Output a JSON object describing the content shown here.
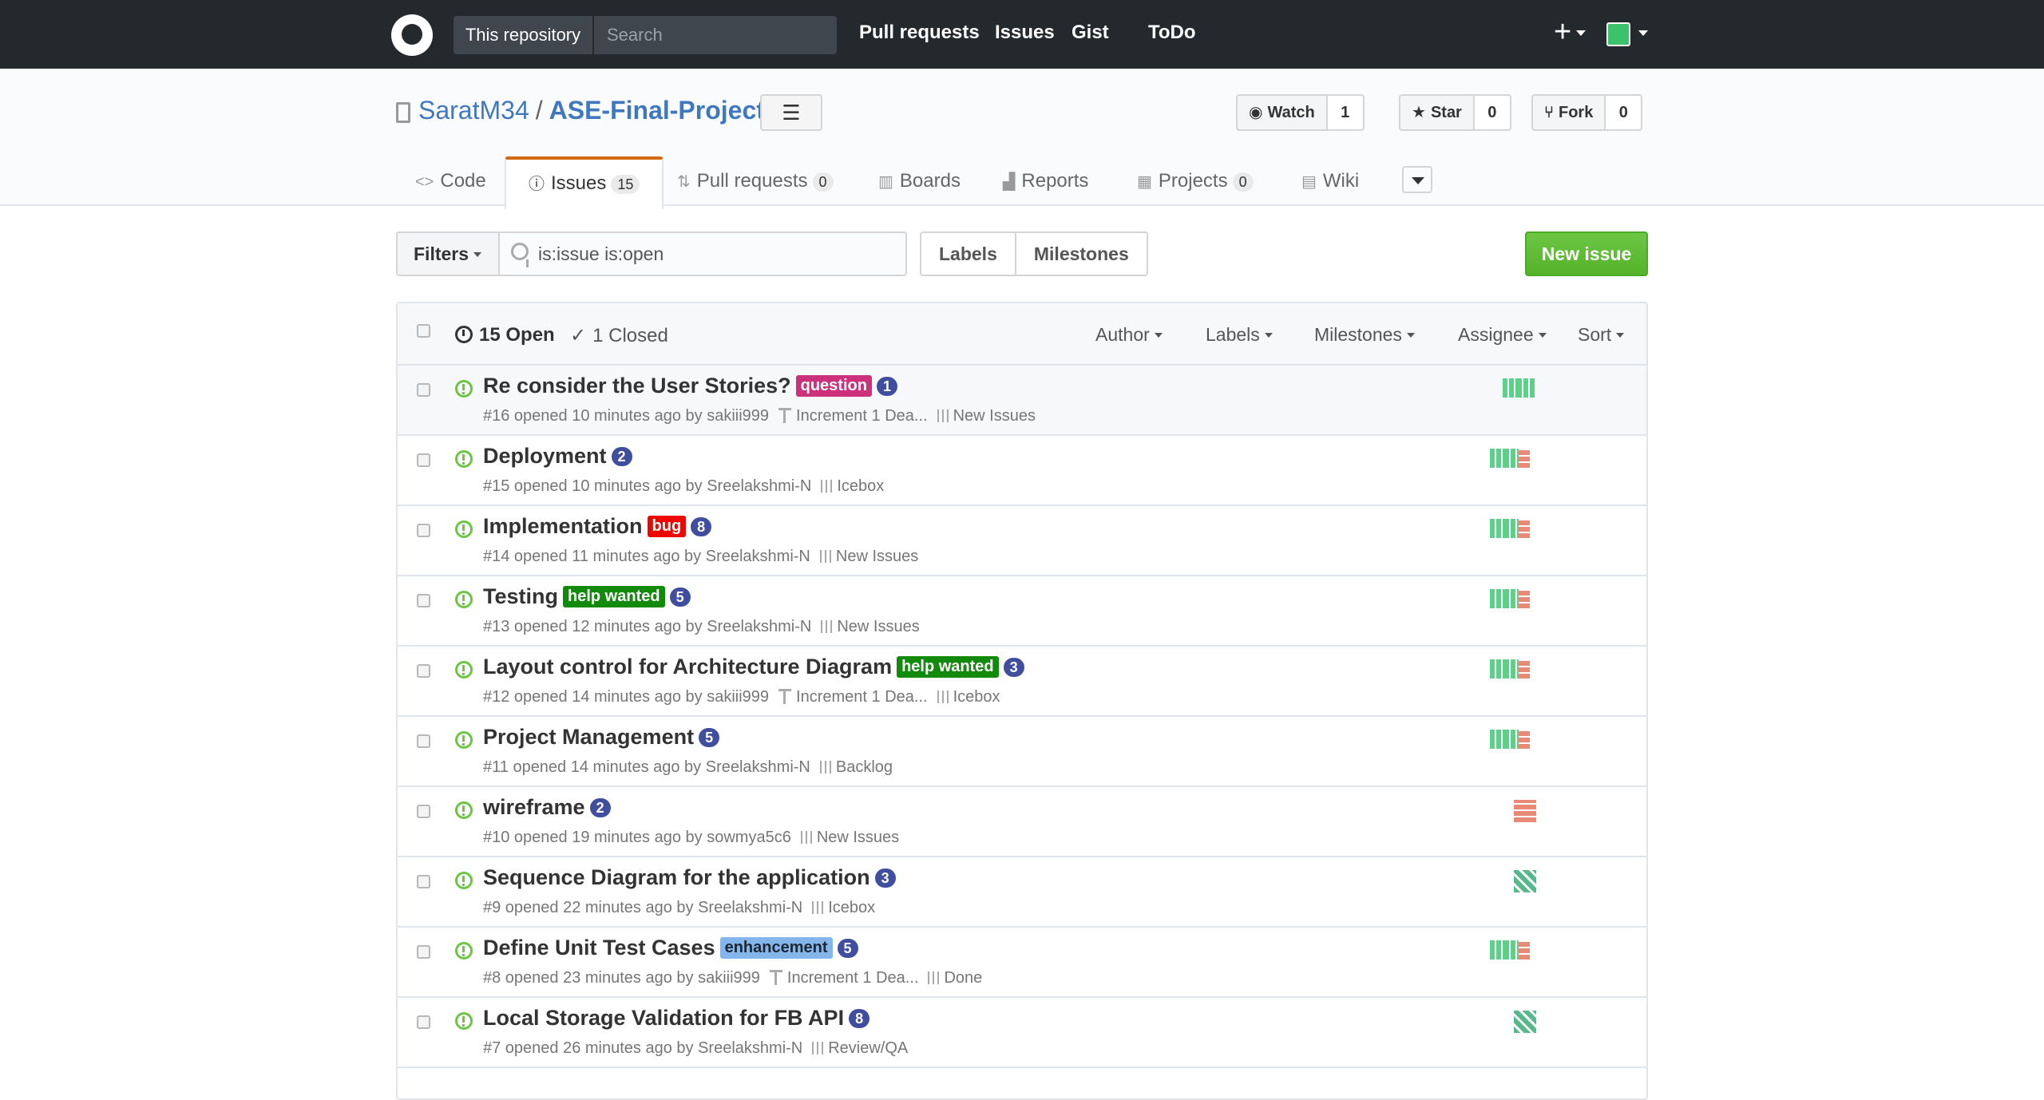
{
  "header": {
    "scope_label": "This repository",
    "search_placeholder": "Search",
    "nav": [
      "Pull requests",
      "Issues",
      "Gist",
      "ToDo"
    ],
    "plus_label": "+"
  },
  "repo": {
    "owner": "SaratM34",
    "separator": "/",
    "name": "ASE-Final-Project",
    "list_icon": "☰",
    "watch": {
      "label": "Watch",
      "count": "1"
    },
    "star": {
      "label": "Star",
      "count": "0"
    },
    "fork": {
      "label": "Fork",
      "count": "0"
    }
  },
  "tabs": {
    "code": {
      "label": "Code",
      "icon": "<>"
    },
    "issues": {
      "label": "Issues",
      "count": "15"
    },
    "pulls": {
      "label": "Pull requests",
      "count": "0"
    },
    "boards": {
      "label": "Boards"
    },
    "reports": {
      "label": "Reports"
    },
    "projects": {
      "label": "Projects",
      "count": "0"
    },
    "wiki": {
      "label": "Wiki"
    }
  },
  "subnav": {
    "filters": "Filters",
    "query": "is:issue is:open",
    "labels": "Labels",
    "milestones": "Milestones",
    "new_issue": "New issue"
  },
  "list_header": {
    "open": "15 Open",
    "closed_check": "✓",
    "closed": "1 Closed",
    "author": "Author",
    "labels": "Labels",
    "milestones": "Milestones",
    "assignee": "Assignee",
    "sort": "Sort"
  },
  "colors": {
    "label_question": "#cc317c",
    "label_bug": "#ee0701",
    "label_help_wanted": "#128a0c",
    "label_enhancement": "#84b6eb",
    "comment_badge": "#3f4e9f",
    "open_icon": "#6cc644",
    "new_issue_button": "#6cc644",
    "selected_tab_border": "#d26911"
  },
  "issues": [
    {
      "title": "Re consider the User Stories?",
      "label": "question",
      "comments": "1",
      "meta": "#16 opened 10 minutes ago by sakiii999",
      "milestone": "Increment 1 Dea...",
      "column": "New Issues"
    },
    {
      "title": "Deployment",
      "label": "",
      "comments": "2",
      "meta": "#15 opened 10 minutes ago by Sreelakshmi-N",
      "milestone": "",
      "column": "Icebox"
    },
    {
      "title": "Implementation",
      "label": "bug",
      "comments": "8",
      "meta": "#14 opened 11 minutes ago by Sreelakshmi-N",
      "milestone": "",
      "column": "New Issues"
    },
    {
      "title": "Testing",
      "label": "help wanted",
      "comments": "5",
      "meta": "#13 opened 12 minutes ago by Sreelakshmi-N",
      "milestone": "",
      "column": "New Issues"
    },
    {
      "title": "Layout control for Architecture Diagram",
      "label": "help wanted",
      "comments": "3",
      "meta": "#12 opened 14 minutes ago by sakiii999",
      "milestone": "Increment 1 Dea...",
      "column": "Icebox"
    },
    {
      "title": "Project Management",
      "label": "",
      "comments": "5",
      "meta": "#11 opened 14 minutes ago by Sreelakshmi-N",
      "milestone": "",
      "column": "Backlog"
    },
    {
      "title": "wireframe",
      "label": "",
      "comments": "2",
      "meta": "#10 opened 19 minutes ago by sowmya5c6",
      "milestone": "",
      "column": "New Issues"
    },
    {
      "title": "Sequence Diagram for the application",
      "label": "",
      "comments": "3",
      "meta": "#9 opened 22 minutes ago by Sreelakshmi-N",
      "milestone": "",
      "column": "Icebox"
    },
    {
      "title": "Define Unit Test Cases",
      "label": "enhancement",
      "comments": "5",
      "meta": "#8 opened 23 minutes ago by sakiii999",
      "milestone": "Increment 1 Dea...",
      "column": "Done"
    },
    {
      "title": "Local Storage Validation for FB API",
      "label": "",
      "comments": "8",
      "meta": "#7 opened 26 minutes ago by Sreelakshmi-N",
      "milestone": "",
      "column": "Review/QA"
    }
  ]
}
